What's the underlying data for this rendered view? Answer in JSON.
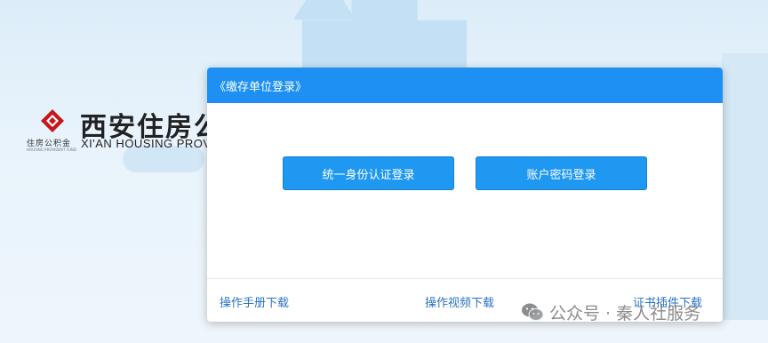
{
  "brand": {
    "name_cn": "西安住房公积金",
    "name_en": "XI'AN HOUSING PROVIDENT FUND",
    "logo_text_small": "住房公积金",
    "logo_text_tiny": "HOUSING PROVIDENT FUND",
    "logo_icon": "diamond-logo-icon"
  },
  "dialog": {
    "title": "《缴存单位登录》",
    "buttons": {
      "ca_login": "统一身份认证登录",
      "password_login": "账户密码登录"
    },
    "footer": {
      "manual_download": "操作手册下载",
      "video_download": "操作视频下载",
      "cert_plugin_download": "证书插件下载"
    }
  },
  "watermark": {
    "icon": "wechat-icon",
    "text": "公众号 · 秦人社服务"
  },
  "colors": {
    "header_blue": "#1e90f3",
    "button_blue": "#1e98f1",
    "link_blue": "#2a73c4",
    "brand_red": "#c8161d"
  }
}
